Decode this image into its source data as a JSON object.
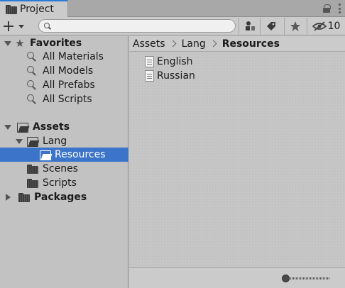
{
  "tab": {
    "title": "Project"
  },
  "toolbar": {
    "search": {
      "value": "",
      "placeholder": ""
    },
    "hidden_packages_count": "10"
  },
  "tree": {
    "favorites": {
      "label": "Favorites",
      "items": [
        "All Materials",
        "All Models",
        "All Prefabs",
        "All Scripts"
      ]
    },
    "assets": {
      "label": "Assets",
      "lang": {
        "label": "Lang",
        "resources": "Resources"
      },
      "scenes": "Scenes",
      "scripts": "Scripts"
    },
    "packages": {
      "label": "Packages"
    }
  },
  "breadcrumb": [
    "Assets",
    "Lang",
    "Resources"
  ],
  "files": [
    "English",
    "Russian"
  ],
  "zoom_slider": {
    "value": 0
  }
}
